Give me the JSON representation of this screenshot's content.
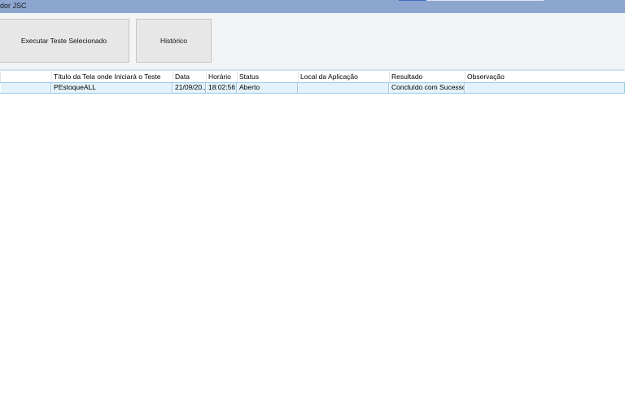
{
  "window": {
    "title": "dor JSC"
  },
  "toolbar": {
    "execute_label": "Executar Teste Selecionado",
    "history_label": "Histórico"
  },
  "table": {
    "columns": [
      "",
      "Título da Tela onde Iniciará o Teste",
      "Data",
      "Horário",
      "Status",
      "Local da Aplicação",
      "Resultado",
      "Observação"
    ],
    "rows": [
      [
        "",
        "PEstoqueALL",
        "21/09/20...",
        "18:02:56",
        "Aberto",
        "",
        "Concluído com Sucesso",
        ""
      ]
    ]
  },
  "colors": {
    "titlebar": "#8ca6cf",
    "toolbar_bg": "#f3f4f6",
    "selected_row": "#e3f2fb",
    "row_border": "#9cc9e6"
  }
}
